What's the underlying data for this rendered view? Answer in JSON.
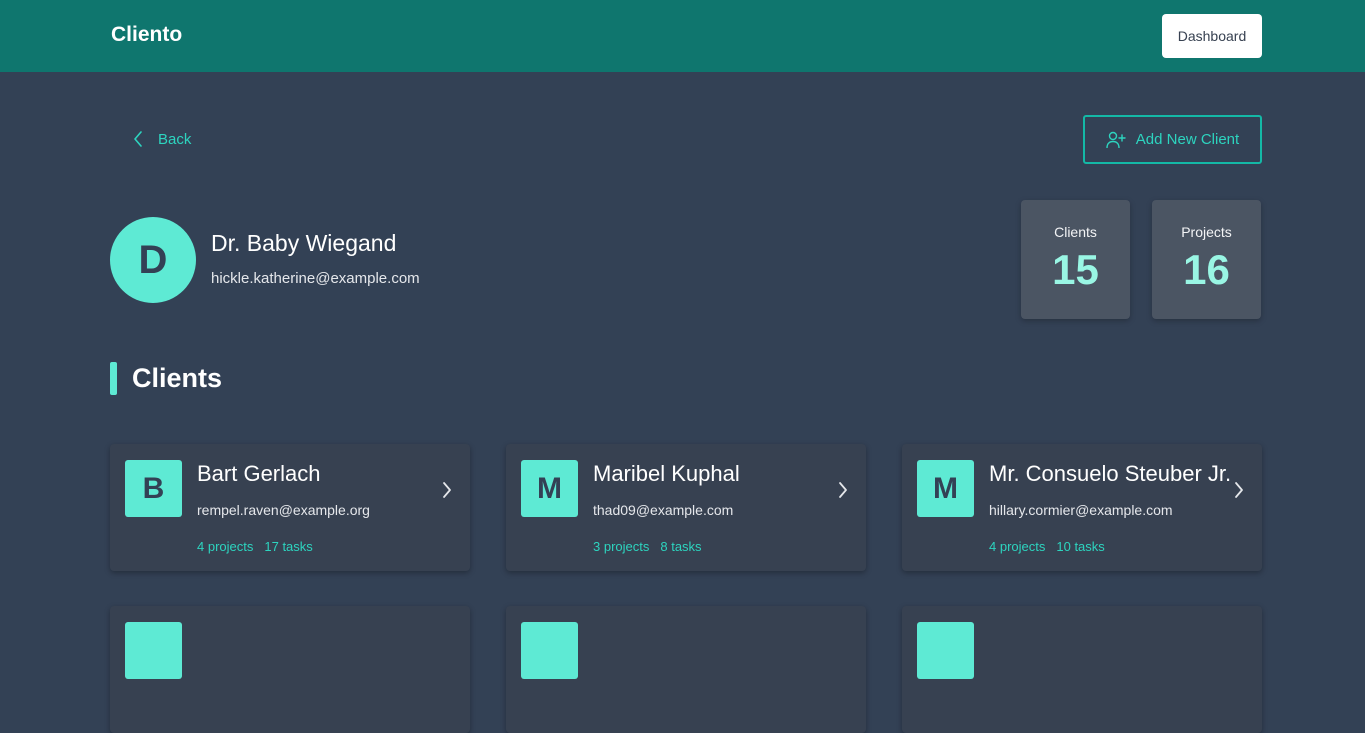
{
  "header": {
    "brand": "Cliento",
    "dashboard_label": "Dashboard"
  },
  "nav": {
    "back_label": "Back",
    "add_client_label": "Add New Client"
  },
  "profile": {
    "initial": "D",
    "name": "Dr. Baby Wiegand",
    "email": "hickle.katherine@example.com"
  },
  "stats": [
    {
      "label": "Clients",
      "value": "15"
    },
    {
      "label": "Projects",
      "value": "16"
    }
  ],
  "section_title": "Clients",
  "clients": [
    {
      "initial": "B",
      "name": "Bart Gerlach",
      "email": "rempel.raven@example.org",
      "projects": "4 projects",
      "tasks": "17 tasks"
    },
    {
      "initial": "M",
      "name": "Maribel Kuphal",
      "email": "thad09@example.com",
      "projects": "3 projects",
      "tasks": "8 tasks"
    },
    {
      "initial": "M",
      "name": "Mr. Consuelo Steuber Jr.",
      "email": "hillary.cormier@example.com",
      "projects": "4 projects",
      "tasks": "10 tasks"
    }
  ],
  "colors": {
    "header_bg": "#0f766e",
    "page_bg": "#334155",
    "accent": "#5eead4",
    "card_bg": "#374151",
    "stat_bg": "#4b5563"
  }
}
